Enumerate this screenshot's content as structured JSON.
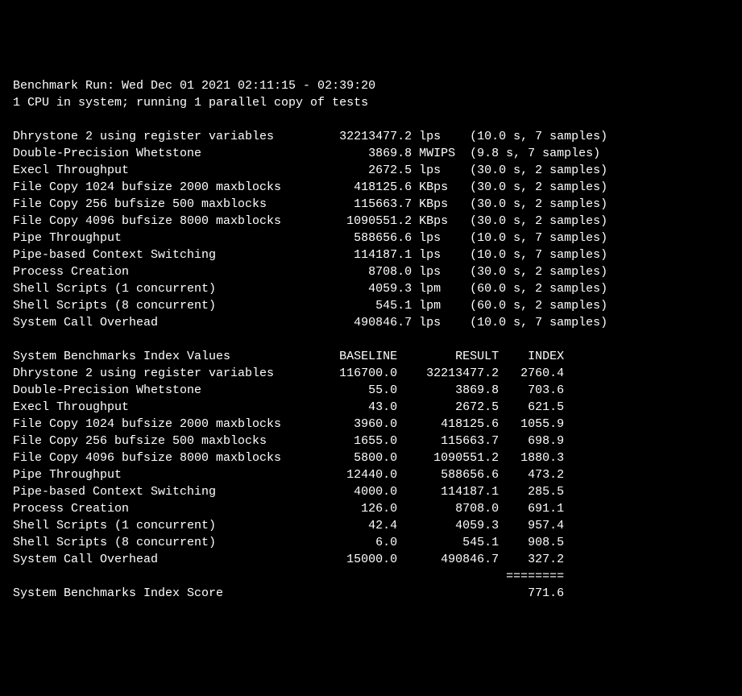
{
  "header": {
    "run_line": "Benchmark Run: Wed Dec 01 2021 02:11:15 - 02:39:20",
    "cpu_line": "1 CPU in system; running 1 parallel copy of tests"
  },
  "tests": [
    {
      "name": "Dhrystone 2 using register variables",
      "value": "32213477.2",
      "unit": "lps",
      "timing": "(10.0 s, 7 samples)"
    },
    {
      "name": "Double-Precision Whetstone",
      "value": "3869.8",
      "unit": "MWIPS",
      "timing": "(9.8 s, 7 samples)"
    },
    {
      "name": "Execl Throughput",
      "value": "2672.5",
      "unit": "lps",
      "timing": "(30.0 s, 2 samples)"
    },
    {
      "name": "File Copy 1024 bufsize 2000 maxblocks",
      "value": "418125.6",
      "unit": "KBps",
      "timing": "(30.0 s, 2 samples)"
    },
    {
      "name": "File Copy 256 bufsize 500 maxblocks",
      "value": "115663.7",
      "unit": "KBps",
      "timing": "(30.0 s, 2 samples)"
    },
    {
      "name": "File Copy 4096 bufsize 8000 maxblocks",
      "value": "1090551.2",
      "unit": "KBps",
      "timing": "(30.0 s, 2 samples)"
    },
    {
      "name": "Pipe Throughput",
      "value": "588656.6",
      "unit": "lps",
      "timing": "(10.0 s, 7 samples)"
    },
    {
      "name": "Pipe-based Context Switching",
      "value": "114187.1",
      "unit": "lps",
      "timing": "(10.0 s, 7 samples)"
    },
    {
      "name": "Process Creation",
      "value": "8708.0",
      "unit": "lps",
      "timing": "(30.0 s, 2 samples)"
    },
    {
      "name": "Shell Scripts (1 concurrent)",
      "value": "4059.3",
      "unit": "lpm",
      "timing": "(60.0 s, 2 samples)"
    },
    {
      "name": "Shell Scripts (8 concurrent)",
      "value": "545.1",
      "unit": "lpm",
      "timing": "(60.0 s, 2 samples)"
    },
    {
      "name": "System Call Overhead",
      "value": "490846.7",
      "unit": "lps",
      "timing": "(10.0 s, 7 samples)"
    }
  ],
  "index_header": {
    "title": "System Benchmarks Index Values",
    "col_baseline": "BASELINE",
    "col_result": "RESULT",
    "col_index": "INDEX"
  },
  "indices": [
    {
      "name": "Dhrystone 2 using register variables",
      "baseline": "116700.0",
      "result": "32213477.2",
      "index": "2760.4"
    },
    {
      "name": "Double-Precision Whetstone",
      "baseline": "55.0",
      "result": "3869.8",
      "index": "703.6"
    },
    {
      "name": "Execl Throughput",
      "baseline": "43.0",
      "result": "2672.5",
      "index": "621.5"
    },
    {
      "name": "File Copy 1024 bufsize 2000 maxblocks",
      "baseline": "3960.0",
      "result": "418125.6",
      "index": "1055.9"
    },
    {
      "name": "File Copy 256 bufsize 500 maxblocks",
      "baseline": "1655.0",
      "result": "115663.7",
      "index": "698.9"
    },
    {
      "name": "File Copy 4096 bufsize 8000 maxblocks",
      "baseline": "5800.0",
      "result": "1090551.2",
      "index": "1880.3"
    },
    {
      "name": "Pipe Throughput",
      "baseline": "12440.0",
      "result": "588656.6",
      "index": "473.2"
    },
    {
      "name": "Pipe-based Context Switching",
      "baseline": "4000.0",
      "result": "114187.1",
      "index": "285.5"
    },
    {
      "name": "Process Creation",
      "baseline": "126.0",
      "result": "8708.0",
      "index": "691.1"
    },
    {
      "name": "Shell Scripts (1 concurrent)",
      "baseline": "42.4",
      "result": "4059.3",
      "index": "957.4"
    },
    {
      "name": "Shell Scripts (8 concurrent)",
      "baseline": "6.0",
      "result": "545.1",
      "index": "908.5"
    },
    {
      "name": "System Call Overhead",
      "baseline": "15000.0",
      "result": "490846.7",
      "index": "327.2"
    }
  ],
  "divider": "========",
  "score": {
    "label": "System Benchmarks Index Score",
    "value": "771.6"
  }
}
